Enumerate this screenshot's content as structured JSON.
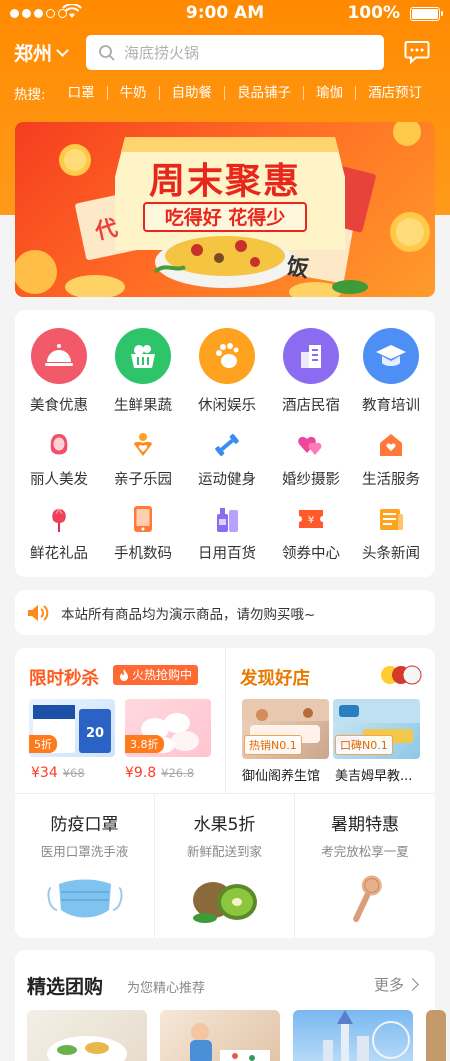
{
  "status": {
    "time": "9:00 AM",
    "battery": "100%"
  },
  "header": {
    "city": "郑州",
    "search_placeholder": "海底捞火锅"
  },
  "hot": {
    "title": "热搜:",
    "keywords": [
      "口罩",
      "牛奶",
      "自助餐",
      "良品铺子",
      "瑜伽",
      "酒店预订"
    ]
  },
  "banner": {
    "title": "周末聚惠",
    "subtitle": "吃得好 花得少",
    "left_char": "代",
    "right_char": "饭"
  },
  "categories": {
    "big": [
      {
        "label": "美食优惠",
        "icon": "food-dome-icon",
        "color": "#f25a6a"
      },
      {
        "label": "生鲜果蔬",
        "icon": "fruit-basket-icon",
        "color": "#2ec46a"
      },
      {
        "label": "休闲娱乐",
        "icon": "footprint-icon",
        "color": "#ffa21f"
      },
      {
        "label": "酒店民宿",
        "icon": "hotel-building-icon",
        "color": "#8b6cf0"
      },
      {
        "label": "教育培训",
        "icon": "graduation-cap-icon",
        "color": "#4d8ff5"
      }
    ],
    "small": [
      {
        "label": "丽人美发",
        "icon": "woman-icon"
      },
      {
        "label": "亲子乐园",
        "icon": "parent-child-icon"
      },
      {
        "label": "运动健身",
        "icon": "dumbbell-icon"
      },
      {
        "label": "婚纱摄影",
        "icon": "hearts-icon"
      },
      {
        "label": "生活服务",
        "icon": "house-heart-icon"
      },
      {
        "label": "鲜花礼品",
        "icon": "flower-icon"
      },
      {
        "label": "手机数码",
        "icon": "phone-icon"
      },
      {
        "label": "日用百货",
        "icon": "bottles-icon"
      },
      {
        "label": "领券中心",
        "icon": "coupon-icon"
      },
      {
        "label": "头条新闻",
        "icon": "news-icon"
      }
    ]
  },
  "notice": {
    "text": "本站所有商品均为演示商品，请勿购买哦~"
  },
  "flash_sale": {
    "title": "限时秒杀",
    "badge": "火热抢购中",
    "products": [
      {
        "discount": "5折",
        "price": "¥34",
        "old_price": "¥68"
      },
      {
        "discount": "3.8折",
        "price": "¥9.8",
        "old_price": "¥26.8"
      }
    ]
  },
  "stores": {
    "title": "发现好店",
    "items": [
      {
        "badge": "热销N0.1",
        "name": "御仙阁养生馆"
      },
      {
        "badge": "口碑N0.1",
        "name": "美吉姆早教..."
      }
    ]
  },
  "features": [
    {
      "title": "防疫口罩",
      "sub": "医用口罩洗手液",
      "icon": "mask-icon"
    },
    {
      "title": "水果5折",
      "sub": "新鲜配送到家",
      "icon": "kiwi-icon"
    },
    {
      "title": "暑期特惠",
      "sub": "考完放松享一夏",
      "icon": "microphone-icon"
    }
  ],
  "group": {
    "title": "精选团购",
    "subtitle": "为您精心推荐",
    "more": "更多"
  }
}
